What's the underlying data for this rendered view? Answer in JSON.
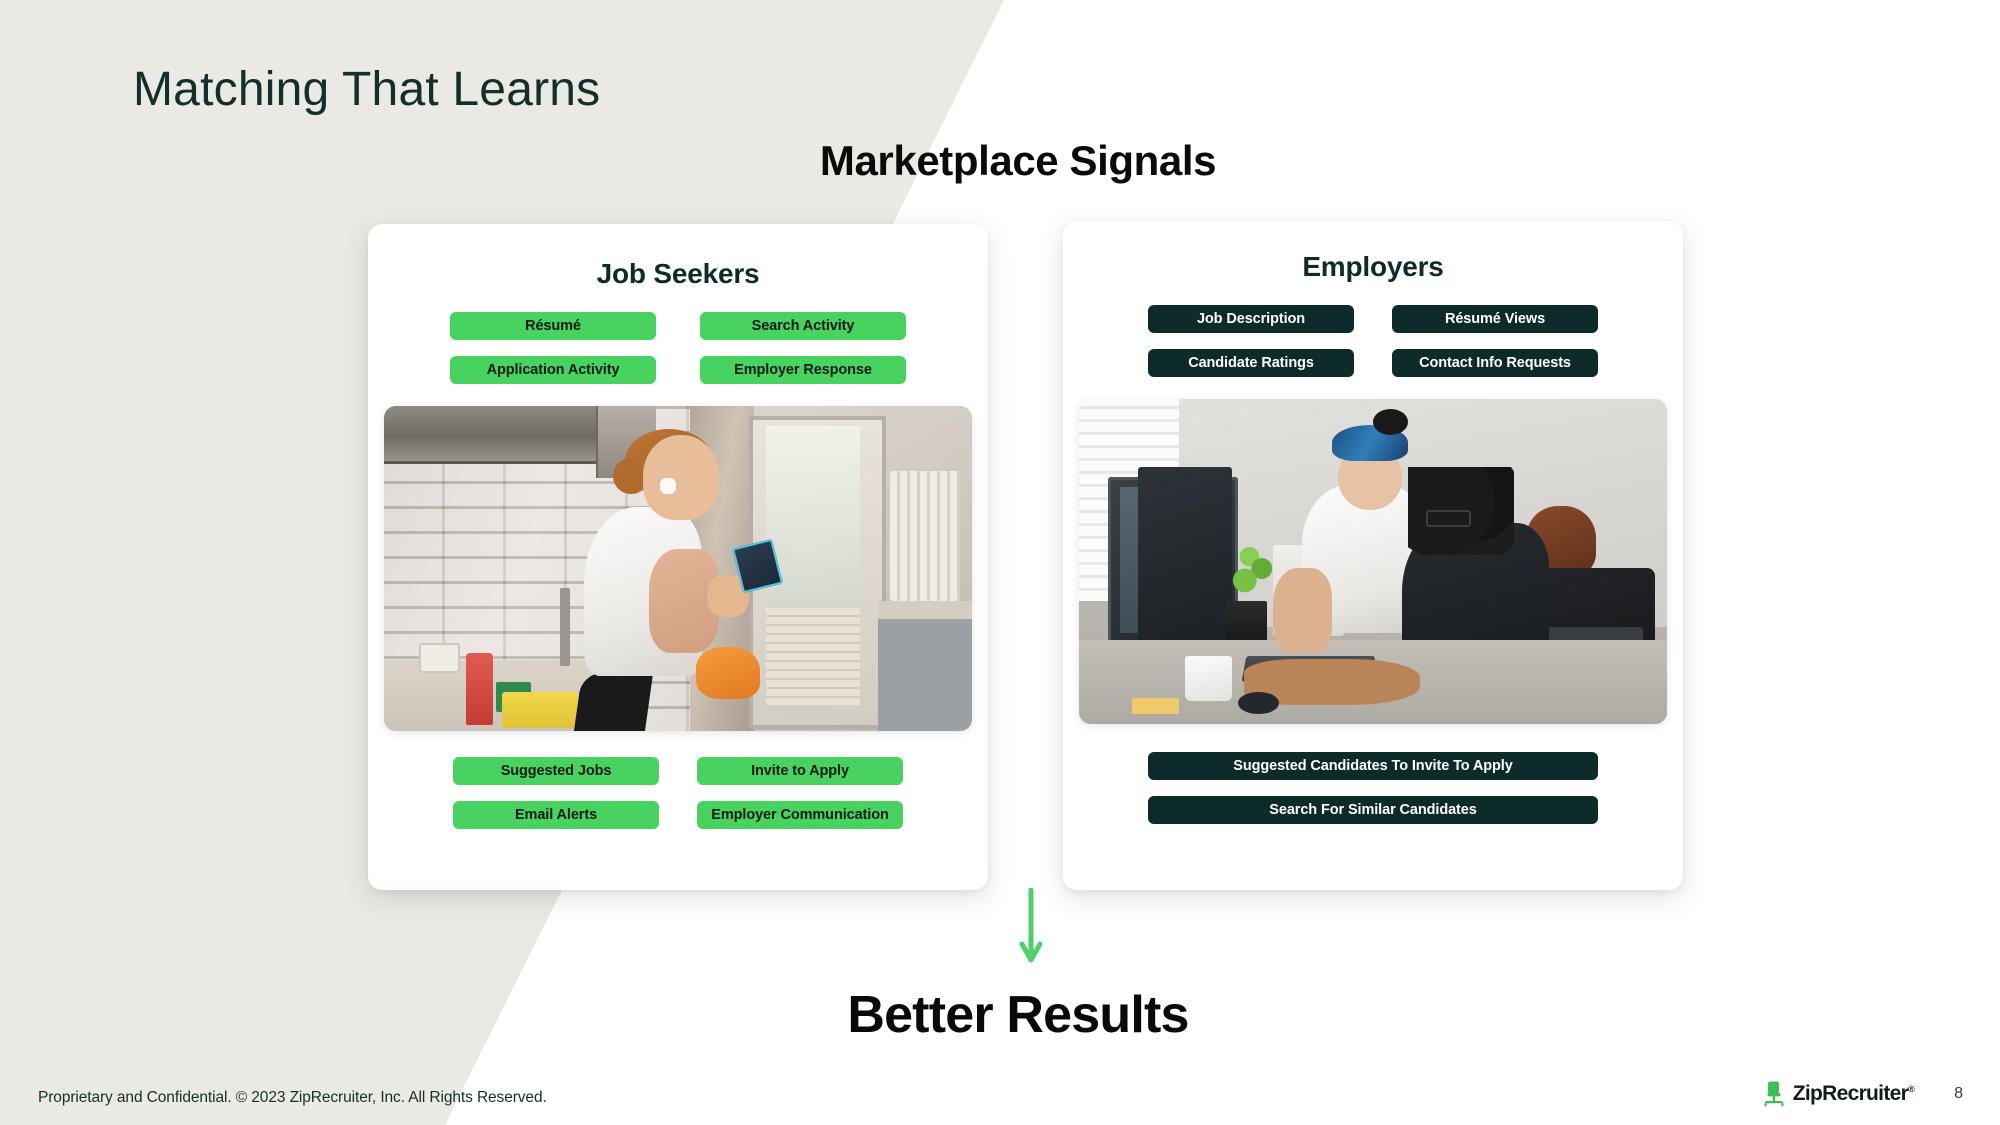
{
  "slide": {
    "title": "Matching That Learns",
    "section_heading": "Marketplace Signals",
    "conclusion": "Better Results",
    "page_number": "8",
    "background_beige": "#ebe9e3",
    "accent_green": "#48d360",
    "accent_dark": "#0d2b28"
  },
  "cards": {
    "job_seekers": {
      "title": "Job Seekers",
      "top_signals": [
        "Résumé",
        "Search Activity",
        "Application Activity",
        "Employer Response"
      ],
      "bottom_signals": [
        "Suggested Jobs",
        "Invite to Apply",
        "Email Alerts",
        "Employer Communication"
      ],
      "photo_alt": "woman in kitchen looking at smartphone"
    },
    "employers": {
      "title": "Employers",
      "top_signals": [
        "Job Description",
        "Résumé Views",
        "Candidate Ratings",
        "Contact Info Requests"
      ],
      "bottom_signals": [
        "Suggested Candidates To Invite To Apply",
        "Search For Similar Candidates"
      ],
      "photo_alt": "three colleagues collaborating at a desk with monitors"
    }
  },
  "arrow": {
    "direction": "down",
    "color": "#4ed16a"
  },
  "footer": {
    "copyright": "Proprietary and Confidential. © 2023 ZipRecruiter, Inc. All Rights Reserved.",
    "logo_name": "ZipRecruiter",
    "logo_tm": "®",
    "logo_icon": "office-chair-icon"
  }
}
